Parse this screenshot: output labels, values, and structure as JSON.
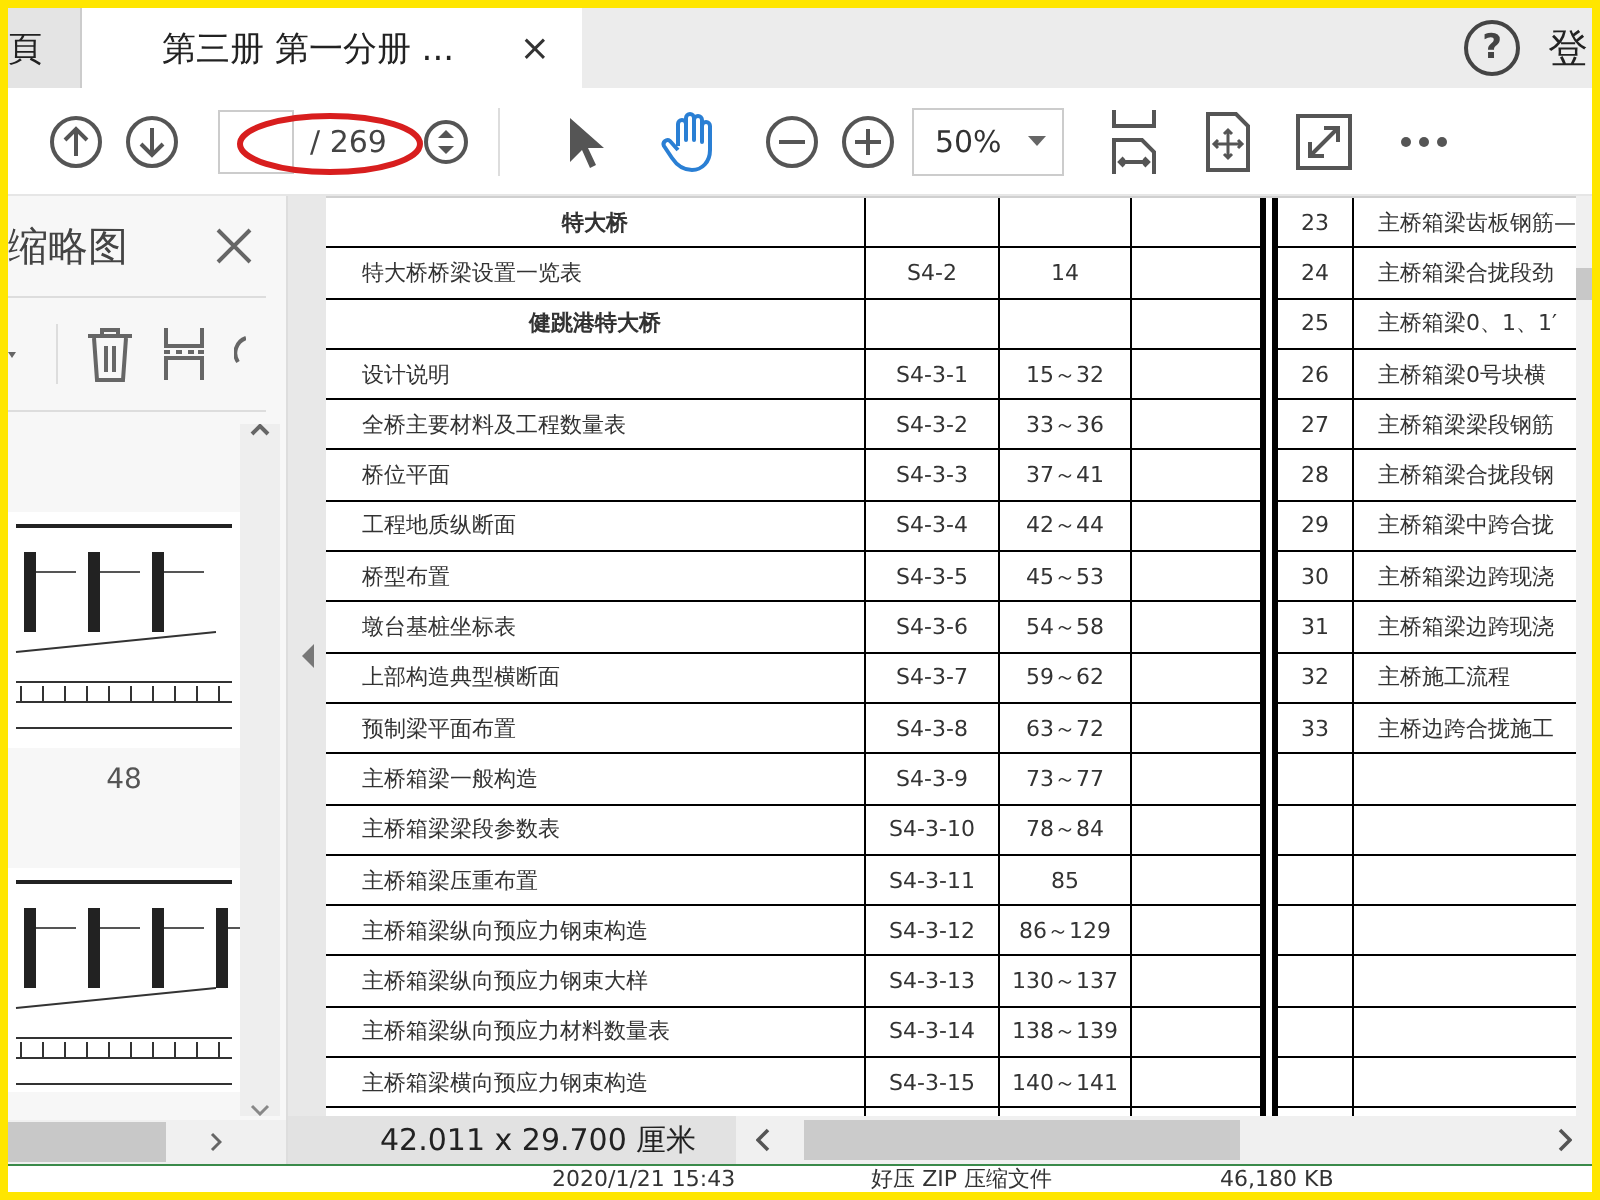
{
  "tabs": [
    {
      "label": "頁",
      "selected": false
    },
    {
      "label": "第三册 第一分册  ...",
      "selected": true,
      "close": "×"
    }
  ],
  "header": {
    "help": "?",
    "login": "登"
  },
  "toolbar": {
    "page_total": "/ 269",
    "zoom": "50%",
    "tools": [
      {
        "kind": "select",
        "selected": false
      },
      {
        "kind": "hand",
        "selected": true
      }
    ]
  },
  "sidebar": {
    "title": "缩略图",
    "thumbnail_label": "48"
  },
  "left_table": {
    "rows": [
      {
        "kind": "section",
        "title": "特大桥"
      },
      {
        "kind": "item",
        "title": "特大桥桥梁设置一览表",
        "code": "S4-2",
        "pages": "14"
      },
      {
        "kind": "section",
        "title": "健跳港特大桥"
      },
      {
        "kind": "item",
        "title": "设计说明",
        "code": "S4-3-1",
        "pages": "15～32"
      },
      {
        "kind": "item",
        "title": "全桥主要材料及工程数量表",
        "code": "S4-3-2",
        "pages": "33～36"
      },
      {
        "kind": "item",
        "title": "桥位平面",
        "code": "S4-3-3",
        "pages": "37～41"
      },
      {
        "kind": "item",
        "title": "工程地质纵断面",
        "code": "S4-3-4",
        "pages": "42～44"
      },
      {
        "kind": "item",
        "title": "桥型布置",
        "code": "S4-3-5",
        "pages": "45～53"
      },
      {
        "kind": "item",
        "title": "墩台基桩坐标表",
        "code": "S4-3-6",
        "pages": "54～58"
      },
      {
        "kind": "item",
        "title": "上部构造典型横断面",
        "code": "S4-3-7",
        "pages": "59～62"
      },
      {
        "kind": "item",
        "title": "预制梁平面布置",
        "code": "S4-3-8",
        "pages": "63～72"
      },
      {
        "kind": "item",
        "title": "主桥箱梁一般构造",
        "code": "S4-3-9",
        "pages": "73～77"
      },
      {
        "kind": "item",
        "title": "主桥箱梁梁段参数表",
        "code": "S4-3-10",
        "pages": "78～84"
      },
      {
        "kind": "item",
        "title": "主桥箱梁压重布置",
        "code": "S4-3-11",
        "pages": "85"
      },
      {
        "kind": "item",
        "title": "主桥箱梁纵向预应力钢束构造",
        "code": "S4-3-12",
        "pages": "86～129"
      },
      {
        "kind": "item",
        "title": "主桥箱梁纵向预应力钢束大样",
        "code": "S4-3-13",
        "pages": "130～137"
      },
      {
        "kind": "item",
        "title": "主桥箱梁纵向预应力材料数量表",
        "code": "S4-3-14",
        "pages": "138～139"
      },
      {
        "kind": "item",
        "title": "主桥箱梁横向预应力钢束构造",
        "code": "S4-3-15",
        "pages": "140～141"
      }
    ]
  },
  "right_table": {
    "rows": [
      {
        "no": "23",
        "title": "主桥箱梁齿板钢筋—"
      },
      {
        "no": "24",
        "title": "主桥箱梁合拢段劲"
      },
      {
        "no": "25",
        "title": "主桥箱梁0、1、1′"
      },
      {
        "no": "26",
        "title": "主桥箱梁0号块横"
      },
      {
        "no": "27",
        "title": "主桥箱梁梁段钢筋"
      },
      {
        "no": "28",
        "title": "主桥箱梁合拢段钢"
      },
      {
        "no": "29",
        "title": "主桥箱梁中跨合拢"
      },
      {
        "no": "30",
        "title": "主桥箱梁边跨现浇"
      },
      {
        "no": "31",
        "title": "主桥箱梁边跨现浇"
      },
      {
        "no": "32",
        "title": "主桥施工流程"
      },
      {
        "no": "33",
        "title": "主桥边跨合拢施工"
      }
    ]
  },
  "status_bar": {
    "page_size": "42.011 x 29.700 厘米"
  },
  "file_row": {
    "date": "2020/1/21 15:43",
    "type": "好压 ZIP 压缩文件",
    "size": "46,180 KB"
  }
}
